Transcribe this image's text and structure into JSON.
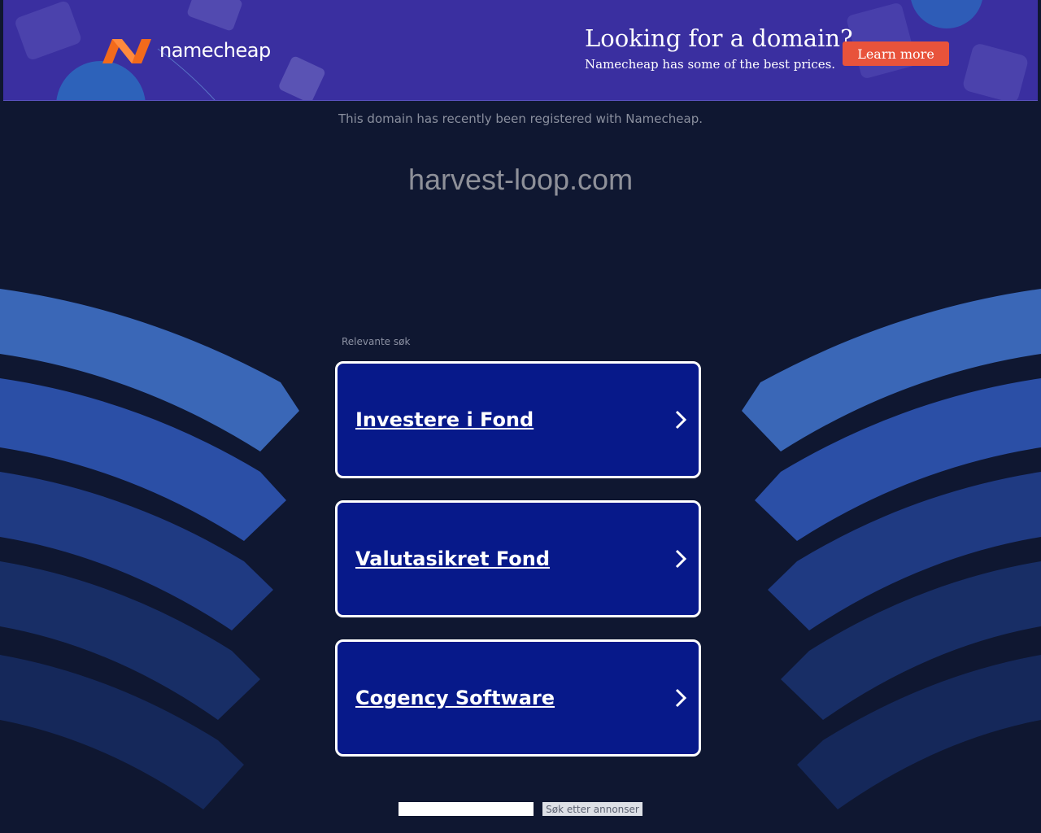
{
  "banner": {
    "logo_text": "namecheap",
    "promo_title": "Looking for a domain?",
    "promo_subtitle": "Namecheap has some of the best prices.",
    "cta_label": "Learn more"
  },
  "notice": "This domain has recently been registered with Namecheap.",
  "domain": "harvest-loop.com",
  "related": {
    "label": "Relevante søk",
    "links": [
      {
        "label": "Investere i Fond"
      },
      {
        "label": "Valutasikret Fond"
      },
      {
        "label": "Cogency Software"
      }
    ]
  },
  "search": {
    "input_value": "",
    "button_label": "Søk etter annonser"
  },
  "colors": {
    "page_bg": "#0f1731",
    "banner_bg": "#3a2fa0",
    "cta": "#e8533b",
    "card_bg": "#07198a",
    "logo_orange": "#f26a1b"
  }
}
